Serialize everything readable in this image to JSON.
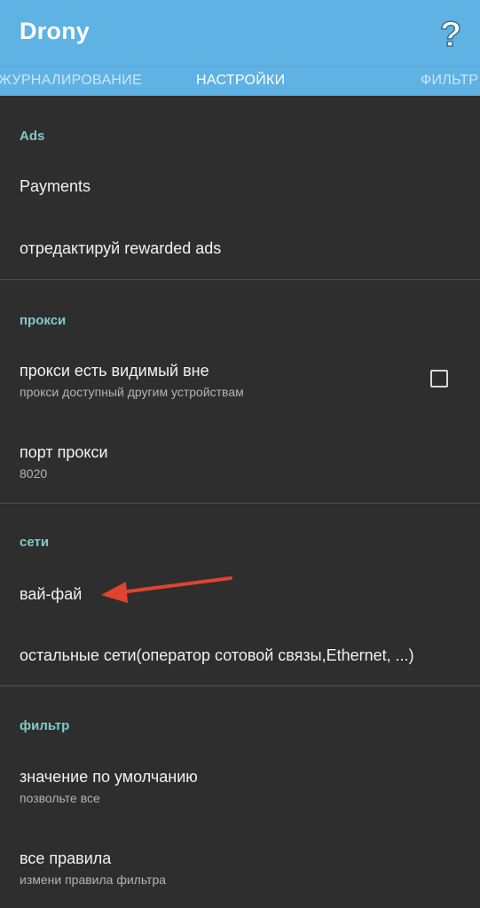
{
  "app": {
    "title": "Drony",
    "help_icon": "question-mark-icon"
  },
  "tabs": [
    {
      "label": "ЖУРНАЛИРОВАНИЕ",
      "active": false
    },
    {
      "label": "НАСТРОЙКИ",
      "active": true
    },
    {
      "label": "ФИЛЬТР",
      "active": false
    }
  ],
  "sections": {
    "ads": {
      "header": "Ads",
      "payments": "Payments",
      "rewarded": "отредактируй rewarded ads"
    },
    "proxy": {
      "header": "прокси",
      "visible_title": "прокси есть видимый вне",
      "visible_sub": "прокси доступный другим устройствам",
      "visible_checked": false,
      "port_title": "порт прокси",
      "port_value": "8020"
    },
    "networks": {
      "header": "сети",
      "wifi": "вай-фай",
      "other": "остальные сети(оператор сотовой связы,Ethernet, ...)"
    },
    "filter": {
      "header": "фильтр",
      "default_title": "значение по умолчанию",
      "default_sub": "позвольте все",
      "rules_title": "все правила",
      "rules_sub": "измени правила фильтра"
    }
  },
  "colors": {
    "appbar": "#5fb2e4",
    "background": "#2e2e2e",
    "section_header": "#7fcbc8",
    "annotation_arrow": "#e0432f"
  }
}
